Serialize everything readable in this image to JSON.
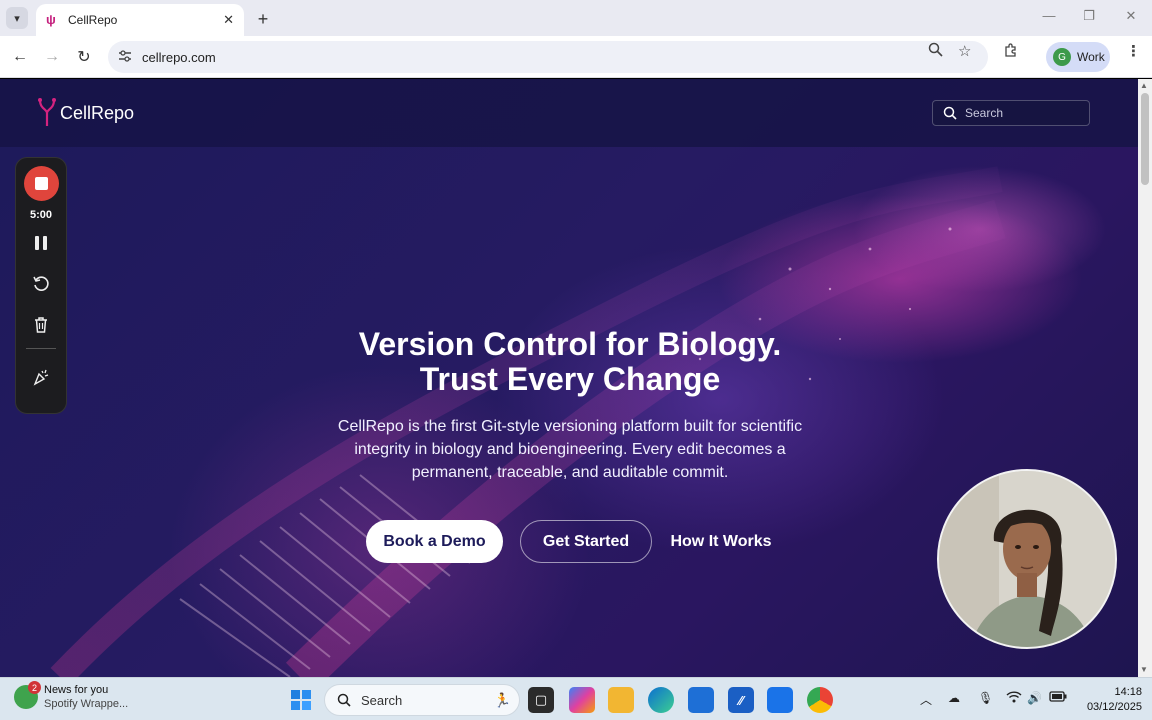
{
  "browser": {
    "tab_title": "CellRepo",
    "url": "cellrepo.com",
    "profile_initial": "G",
    "profile_label": "Work"
  },
  "site": {
    "logo_text": "CellRepo",
    "search_placeholder": "Search",
    "hero_title_line1": "Version Control for Biology.",
    "hero_title_line2": "Trust Every Change",
    "hero_description": "CellRepo is the first Git-style versioning platform built for scientific integrity in biology and bioengineering. Every edit becomes a permanent, traceable, and auditable commit.",
    "buttons": {
      "book_demo": "Book a Demo",
      "get_started": "Get Started",
      "how_it_works": "How It Works"
    }
  },
  "recorder": {
    "time": "5:00"
  },
  "taskbar": {
    "news_title": "News for you",
    "news_subtitle": "Spotify Wrappe...",
    "news_badge": "2",
    "search_placeholder": "Search",
    "time": "14:18",
    "date": "03/12/2025"
  },
  "colors": {
    "accent_pink": "#c5217e",
    "page_bg": "#1d1a5a",
    "record_red": "#e0453c"
  }
}
